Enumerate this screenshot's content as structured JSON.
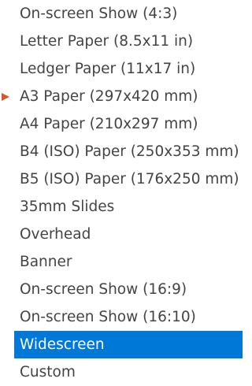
{
  "menu": {
    "items": [
      {
        "label": "On-screen Show (4:3)",
        "selected": false
      },
      {
        "label": "Letter Paper (8.5x11 in)",
        "selected": false
      },
      {
        "label": "Ledger Paper (11x17 in)",
        "selected": false
      },
      {
        "label": "A3 Paper (297x420 mm)",
        "selected": false
      },
      {
        "label": "A4 Paper (210x297 mm)",
        "selected": false
      },
      {
        "label": "B4 (ISO) Paper (250x353 mm)",
        "selected": false
      },
      {
        "label": "B5 (ISO) Paper (176x250 mm)",
        "selected": false
      },
      {
        "label": "35mm Slides",
        "selected": false
      },
      {
        "label": "Overhead",
        "selected": false
      },
      {
        "label": "Banner",
        "selected": false
      },
      {
        "label": "On-screen Show (16:9)",
        "selected": false
      },
      {
        "label": "On-screen Show (16:10)",
        "selected": false
      },
      {
        "label": "Widescreen",
        "selected": true
      },
      {
        "label": "Custom",
        "selected": false
      }
    ]
  },
  "pointer": {
    "icon": "triangle-right-icon",
    "color": "#d4592a"
  },
  "colors": {
    "highlight": "#0078d7",
    "text": "#444444"
  }
}
